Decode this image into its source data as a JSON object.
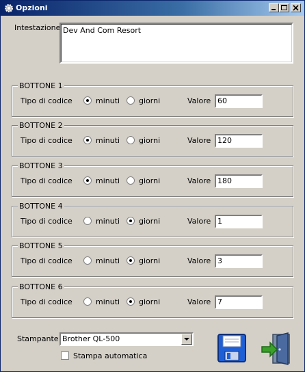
{
  "window": {
    "title": "Opzioni"
  },
  "header": {
    "label": "Intestazione",
    "value": "Dev And Com Resort"
  },
  "common": {
    "type_label": "Tipo di codice",
    "opt_minutes": "minuti",
    "opt_days": "giorni",
    "value_label": "Valore"
  },
  "buttons": [
    {
      "title": "BOTTONE 1",
      "selected": "minuti",
      "value": "60"
    },
    {
      "title": "BOTTONE 2",
      "selected": "minuti",
      "value": "120"
    },
    {
      "title": "BOTTONE 3",
      "selected": "minuti",
      "value": "180"
    },
    {
      "title": "BOTTONE 4",
      "selected": "giorni",
      "value": "1"
    },
    {
      "title": "BOTTONE 5",
      "selected": "giorni",
      "value": "3"
    },
    {
      "title": "BOTTONE 6",
      "selected": "giorni",
      "value": "7"
    }
  ],
  "printer": {
    "label": "Stampante",
    "value": "Brother QL-500",
    "auto_print_label": "Stampa automatica",
    "auto_print_checked": false
  },
  "colors": {
    "titlebar": "#0a246a",
    "dialog_bg": "#d4d0c8",
    "save_icon": "#1f5fd6",
    "exit_arrow": "#3aa02a"
  },
  "icons": {
    "save": "floppy-disk-icon",
    "exit": "exit-door-icon"
  }
}
